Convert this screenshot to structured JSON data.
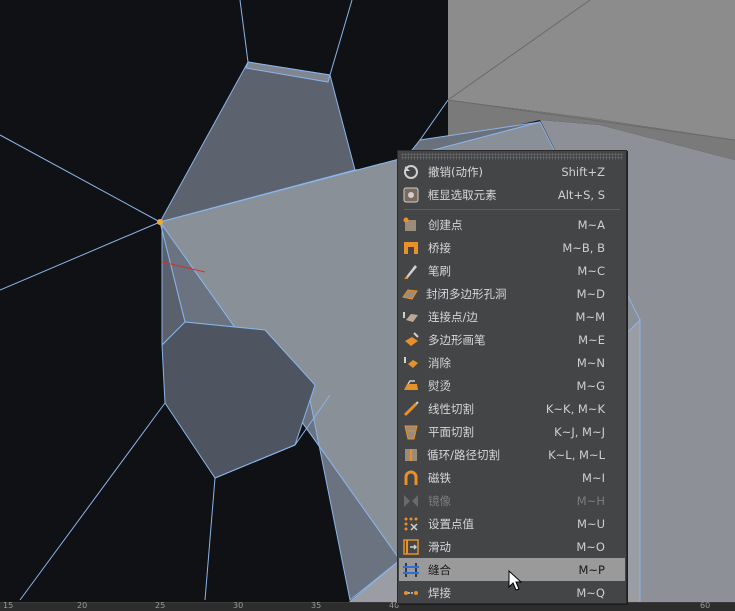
{
  "ruler": {
    "ticks": [
      "15",
      "20",
      "25",
      "30",
      "35",
      "40",
      "60"
    ]
  },
  "menu": {
    "groups": [
      [
        {
          "label": "撤销(动作)",
          "shortcut": "Shift+Z",
          "icon": "undo-icon"
        },
        {
          "label": "框显选取元素",
          "shortcut": "Alt+S, S",
          "icon": "frame-selected-icon"
        }
      ],
      [
        {
          "label": "创建点",
          "shortcut": "M~A",
          "icon": "create-point-icon"
        },
        {
          "label": "桥接",
          "shortcut": "M~B, B",
          "icon": "bridge-icon"
        },
        {
          "label": "笔刷",
          "shortcut": "M~C",
          "icon": "brush-icon"
        },
        {
          "label": "封闭多边形孔洞",
          "shortcut": "M~D",
          "icon": "close-polygon-hole-icon"
        },
        {
          "label": "连接点/边",
          "shortcut": "M~M",
          "icon": "connect-points-edges-icon"
        },
        {
          "label": "多边形画笔",
          "shortcut": "M~E",
          "icon": "polygon-pen-icon"
        },
        {
          "label": "消除",
          "shortcut": "M~N",
          "icon": "dissolve-icon"
        },
        {
          "label": "熨烫",
          "shortcut": "M~G",
          "icon": "iron-icon"
        },
        {
          "label": "线性切割",
          "shortcut": "K~K, M~K",
          "icon": "line-cut-icon"
        },
        {
          "label": "平面切割",
          "shortcut": "K~J, M~J",
          "icon": "plane-cut-icon"
        },
        {
          "label": "循环/路径切割",
          "shortcut": "K~L, M~L",
          "icon": "loop-path-cut-icon"
        },
        {
          "label": "磁铁",
          "shortcut": "M~I",
          "icon": "magnet-icon"
        },
        {
          "label": "镜像",
          "shortcut": "M~H",
          "icon": "mirror-icon",
          "disabled": true
        },
        {
          "label": "设置点值",
          "shortcut": "M~U",
          "icon": "set-point-value-icon"
        },
        {
          "label": "滑动",
          "shortcut": "M~O",
          "icon": "slide-icon"
        },
        {
          "label": "缝合",
          "shortcut": "M~P",
          "icon": "stitch-and-sew-icon",
          "highlighted": true
        },
        {
          "label": "焊接",
          "shortcut": "M~Q",
          "icon": "weld-icon"
        }
      ]
    ]
  },
  "colors": {
    "background": "#101114",
    "mesh_face": "#5f6672",
    "mesh_face_light": "#8a8f97",
    "mesh_edge": "#8ab4e8",
    "selected_point": "#f0a830",
    "menu_bg": "#444547",
    "menu_highlight": "#9a9a9a",
    "icon_orange": "#e8902a"
  }
}
